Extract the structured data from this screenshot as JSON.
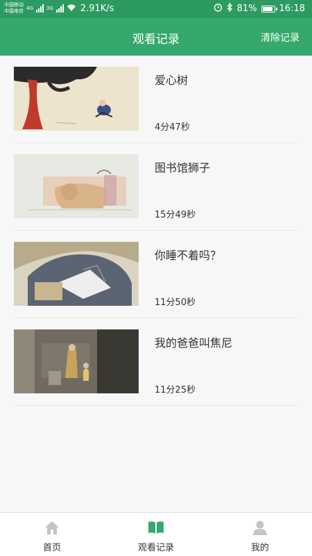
{
  "status_bar": {
    "carrier_1": "中国移动",
    "carrier_2": "中国电信",
    "net_1": "4G",
    "net_2": "3G",
    "net_speed": "2.91K/s",
    "battery_percent": "81%",
    "time": "16:18",
    "icons": [
      "alarm-icon",
      "bluetooth-icon",
      "battery-icon",
      "wifi-icon",
      "signal-icon"
    ]
  },
  "header": {
    "title": "观看记录",
    "clear_label": "清除记录"
  },
  "history": [
    {
      "title": "爱心树",
      "duration": "4分47秒"
    },
    {
      "title": "图书馆狮子",
      "duration": "15分49秒"
    },
    {
      "title": "你睡不着吗？",
      "duration": "11分50秒"
    },
    {
      "title": "我的爸爸叫焦尼",
      "duration": "11分25秒"
    }
  ],
  "tabs": [
    {
      "label": "首页",
      "icon": "home-icon",
      "active": false
    },
    {
      "label": "观看记录",
      "icon": "book-icon",
      "active": true
    },
    {
      "label": "我的",
      "icon": "profile-icon",
      "active": false
    }
  ],
  "colors": {
    "status_bar": "#2d9a60",
    "header": "#35a96b",
    "accent": "#35a96b",
    "inactive_icon": "#c4c4c4"
  }
}
